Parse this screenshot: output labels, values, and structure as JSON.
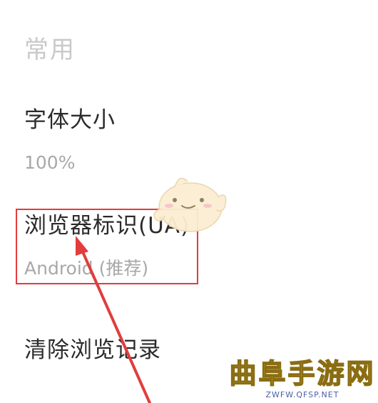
{
  "section": {
    "title": "常用"
  },
  "settings": {
    "font_size": {
      "title": "字体大小",
      "value": "100%"
    },
    "user_agent": {
      "title": "浏览器标识(UA)",
      "value": "Android (推荐)"
    },
    "clear_history": {
      "title": "清除浏览记录"
    }
  },
  "annotation": {
    "box_color": "#e23c3c",
    "arrow_color": "#e23c3c"
  },
  "watermark": {
    "title": "曲阜手游网",
    "url": "ZWFW.QFSP.NET"
  },
  "icons": [
    "mascot-icon"
  ]
}
